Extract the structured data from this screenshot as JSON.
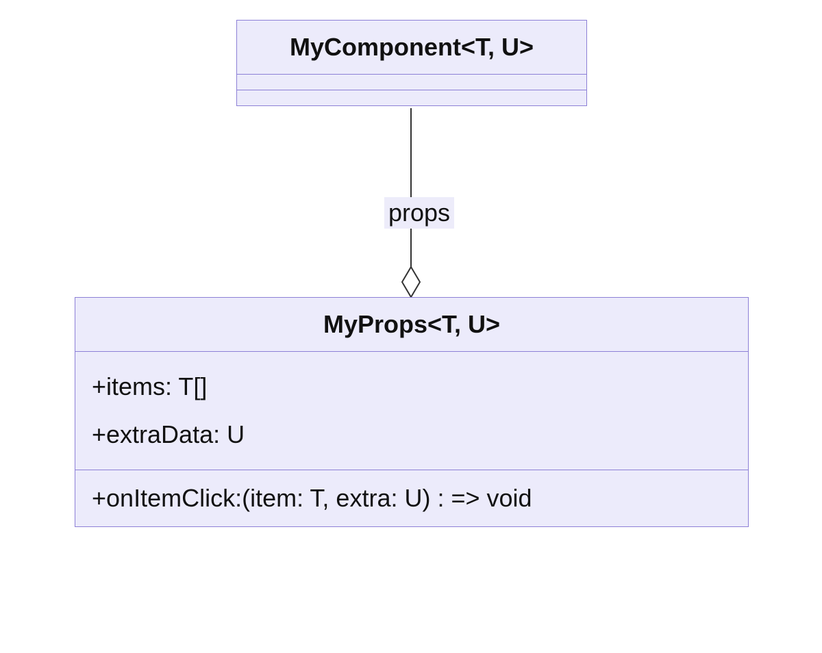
{
  "diagram": {
    "type": "uml-class",
    "classes": [
      {
        "id": "mycomponent",
        "name": "MyComponent<T, U>",
        "attributes": [],
        "methods": []
      },
      {
        "id": "myprops",
        "name": "MyProps<T, U>",
        "attributes": [
          "+items: T[]",
          "+extraData: U"
        ],
        "methods": [
          "+onItemClick:(item: T, extra: U) : => void"
        ]
      }
    ],
    "relations": [
      {
        "from": "mycomponent",
        "to": "myprops",
        "type": "aggregation",
        "label": "props"
      }
    ],
    "colors": {
      "box_fill": "#ecebfb",
      "box_border": "#8c7fd6",
      "label_bg": "#edecfa",
      "line": "#333333"
    }
  }
}
